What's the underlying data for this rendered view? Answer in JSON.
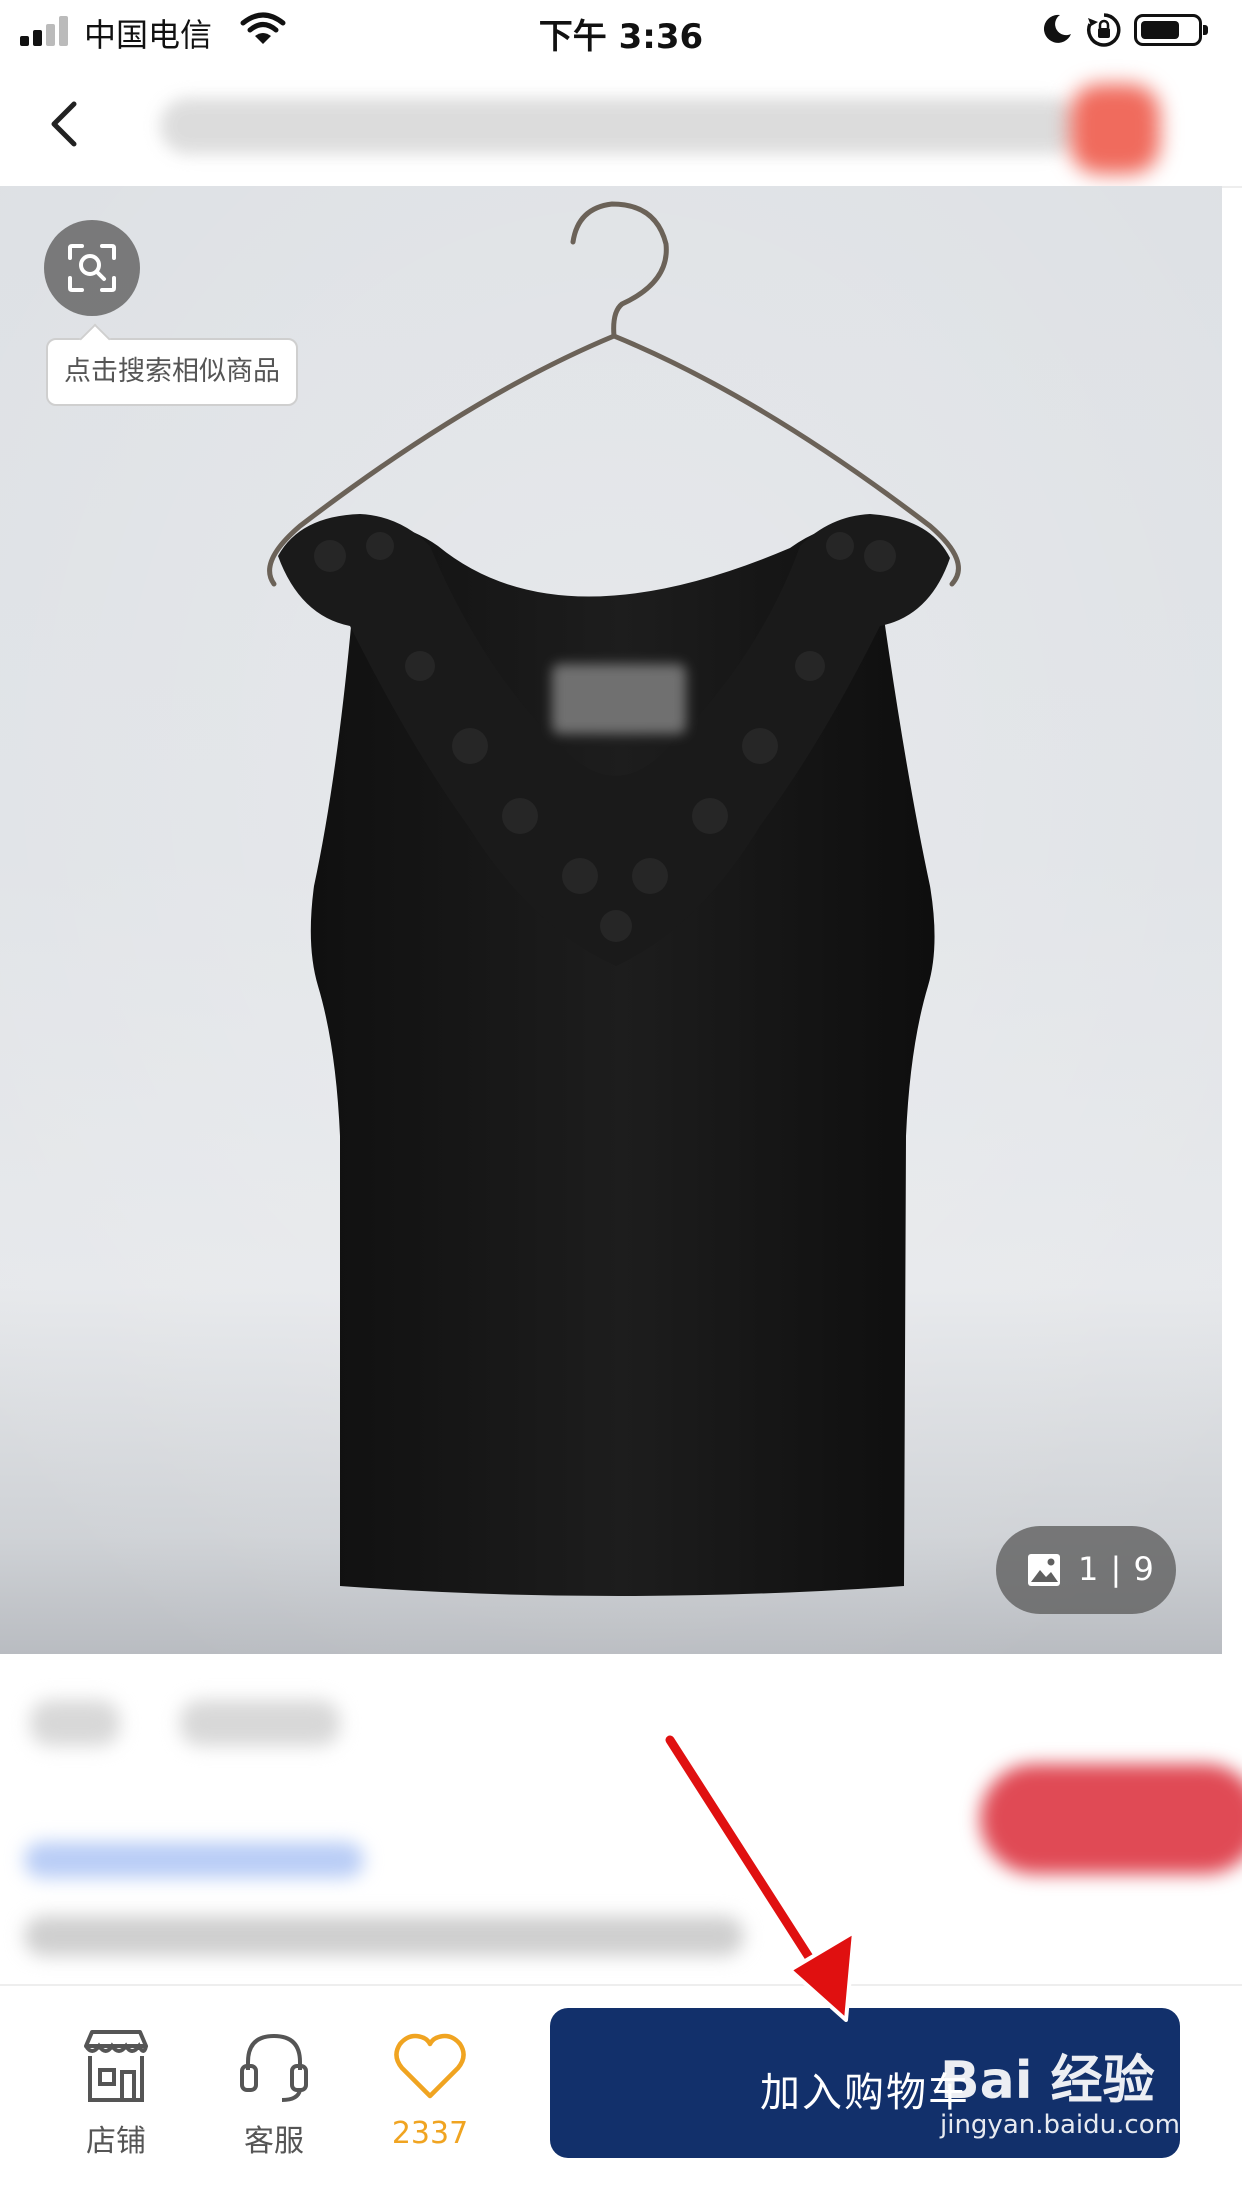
{
  "status_bar": {
    "carrier": "中国电信",
    "time": "下午 3:36"
  },
  "hero": {
    "search_tooltip": "点击搜索相似商品",
    "image_counter": "1 | 9"
  },
  "bottom_bar": {
    "shop_label": "店铺",
    "service_label": "客服",
    "favorite_count": "2337",
    "add_to_cart_label": "加入购物车"
  },
  "watermark": {
    "logo_text": "Bai 经验",
    "url": "jingyan.baidu.com"
  },
  "colors": {
    "cart_button": "#12306b",
    "favorite_accent": "#f0a421",
    "annotation_arrow": "#e01010"
  }
}
